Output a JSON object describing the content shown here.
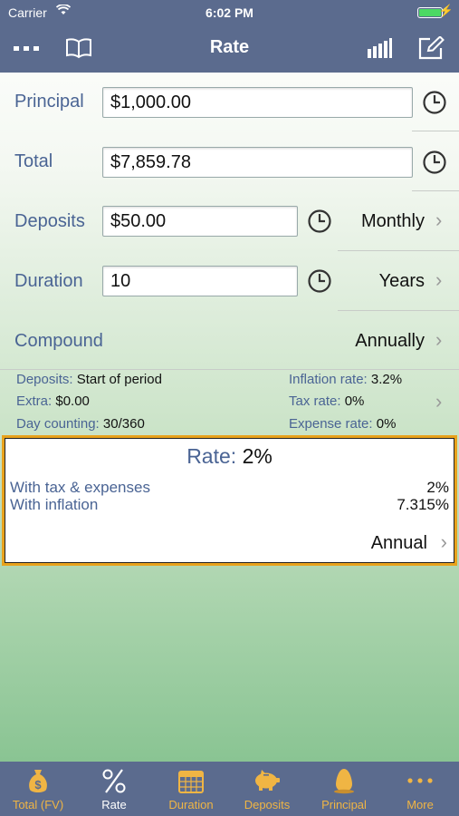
{
  "status": {
    "carrier": "Carrier",
    "time": "6:02 PM"
  },
  "nav": {
    "title": "Rate"
  },
  "form": {
    "principal": {
      "label": "Principal",
      "value": "$1,000.00"
    },
    "total": {
      "label": "Total",
      "value": "$7,859.78"
    },
    "deposits": {
      "label": "Deposits",
      "value": "$50.00",
      "frequency": "Monthly"
    },
    "duration": {
      "label": "Duration",
      "value": "10",
      "unit": "Years"
    },
    "compound": {
      "label": "Compound",
      "value": "Annually"
    }
  },
  "info": {
    "deposits_label": "Deposits:",
    "deposits_value": "Start of period",
    "extra_label": "Extra:",
    "extra_value": "$0.00",
    "day_label": "Day counting:",
    "day_value": "30/360",
    "inflation_label": "Inflation rate:",
    "inflation_value": "3.2%",
    "tax_label": "Tax rate:",
    "tax_value": "0%",
    "expense_label": "Expense rate:",
    "expense_value": "0%"
  },
  "result": {
    "title_label": "Rate:",
    "title_value": "2%",
    "tax_label": "With tax & expenses",
    "tax_value": "2%",
    "inflation_label": "With inflation",
    "inflation_value": "7.315%",
    "period": "Annual"
  },
  "tabs": [
    {
      "label": "Total (FV)",
      "icon": "money-bag-icon"
    },
    {
      "label": "Rate",
      "icon": "percent-icon"
    },
    {
      "label": "Duration",
      "icon": "calendar-icon"
    },
    {
      "label": "Deposits",
      "icon": "piggy-bank-icon"
    },
    {
      "label": "Principal",
      "icon": "egg-icon"
    },
    {
      "label": "More",
      "icon": "more-dots-icon"
    }
  ],
  "colors": {
    "bar": "#5b6b8e",
    "accent": "#f0b544",
    "label": "#4a6494",
    "highlight": "#e8a21c"
  }
}
